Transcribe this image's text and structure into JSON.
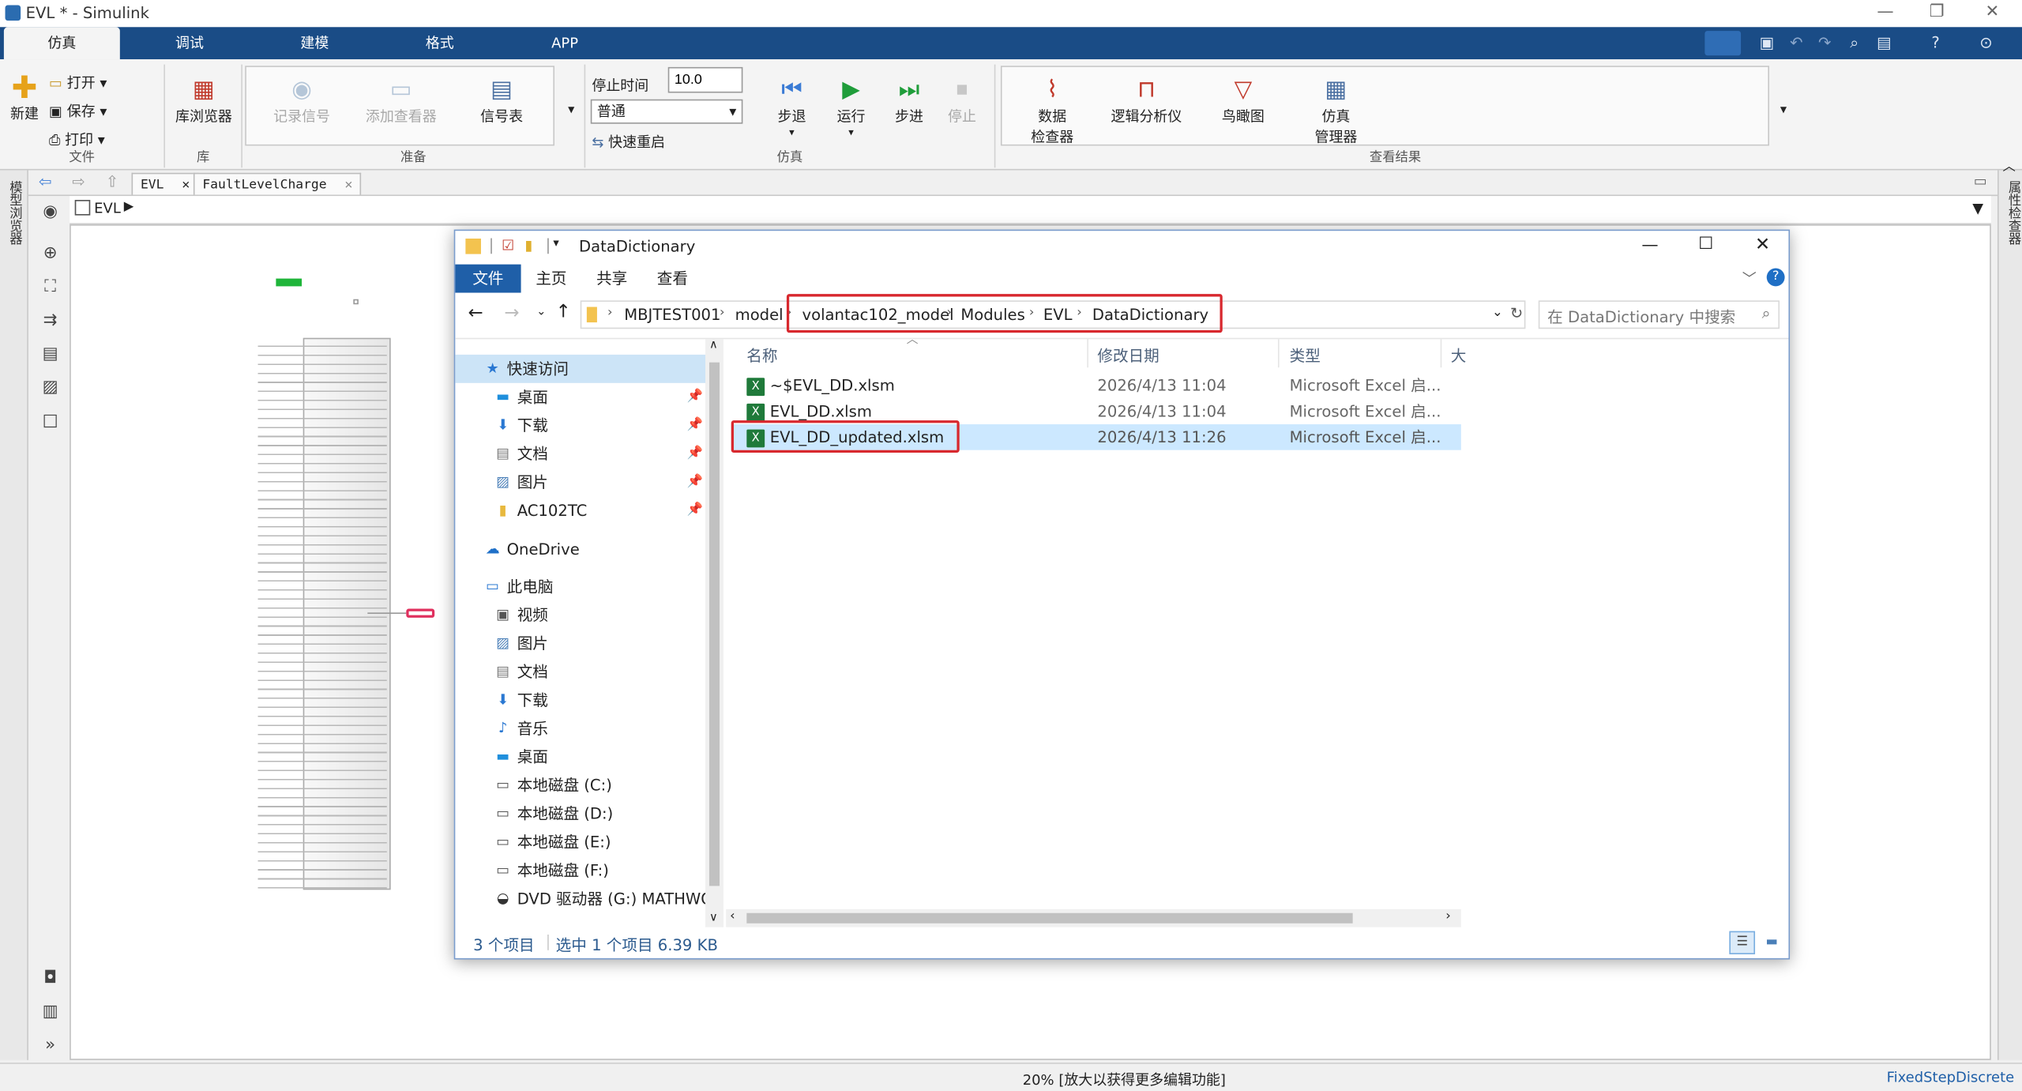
{
  "window": {
    "title": "EVL * - Simulink"
  },
  "ribbon_tabs": [
    "仿真",
    "调试",
    "建模",
    "格式",
    "APP"
  ],
  "ribbon": {
    "file_group": {
      "new": "新建",
      "open": "打开",
      "save": "保存",
      "print": "打印",
      "label": "文件"
    },
    "library_group": {
      "browser": "库浏览器",
      "label": "库"
    },
    "prepare_group": {
      "log_signals": "记录信号",
      "add_viewer": "添加查看器",
      "signal_table": "信号表",
      "label": "准备"
    },
    "simulate_group": {
      "stop_time_label": "停止时间",
      "stop_time_value": "10.0",
      "mode_value": "普通",
      "fast_restart": "快速重启",
      "step_back": "步退",
      "run": "运行",
      "step_forward": "步进",
      "stop": "停止",
      "label": "仿真"
    },
    "review_group": {
      "data_inspector_line1": "数据",
      "data_inspector_line2": "检查器",
      "logic_analyzer": "逻辑分析仪",
      "birds_eye": "鸟瞰图",
      "sim_manager_line1": "仿真",
      "sim_manager_line2": "管理器",
      "label": "查看结果"
    }
  },
  "side_panels": {
    "left": "模型浏览器",
    "right": "属性检查器"
  },
  "doc_tabs": [
    "EVL",
    "FaultLevelCharge"
  ],
  "model_path": "EVL",
  "status": {
    "zoom_text": "20% [放大以获得更多编辑功能]",
    "solver": "FixedStepDiscrete"
  },
  "explorer": {
    "title": "DataDictionary",
    "tabs": [
      "文件",
      "主页",
      "共享",
      "查看"
    ],
    "breadcrumbs": [
      "MBJTEST001",
      "model",
      "volantac102_model",
      "Modules",
      "EVL",
      "DataDictionary"
    ],
    "search_placeholder": "在 DataDictionary 中搜索",
    "nav": {
      "quick_access": "快速访问",
      "quick_items": [
        "桌面",
        "下载",
        "文档",
        "图片",
        "AC102TC"
      ],
      "onedrive": "OneDrive",
      "this_pc": "此电脑",
      "pc_items": [
        "视频",
        "图片",
        "文档",
        "下载",
        "音乐",
        "桌面",
        "本地磁盘 (C:)",
        "本地磁盘 (D:)",
        "本地磁盘 (E:)",
        "本地磁盘 (F:)",
        "DVD 驱动器 (G:) MATHWOR"
      ]
    },
    "columns": [
      "名称",
      "修改日期",
      "类型",
      "大"
    ],
    "files": [
      {
        "name": "~$EVL_DD.xlsm",
        "date": "2026/4/13 11:04",
        "type": "Microsoft Excel 启..."
      },
      {
        "name": "EVL_DD.xlsm",
        "date": "2026/4/13 11:04",
        "type": "Microsoft Excel 启..."
      },
      {
        "name": "EVL_DD_updated.xlsm",
        "date": "2026/4/13 11:26",
        "type": "Microsoft Excel 启..."
      }
    ],
    "status_count": "3 个项目",
    "status_selected": "选中 1 个项目  6.39 KB"
  },
  "colors": {
    "ribbon_tab_bg": "#1a4c86",
    "explorer_tab_active": "#1f5fa8",
    "highlight_red": "#d8282e",
    "selection": "#cce8ff"
  }
}
